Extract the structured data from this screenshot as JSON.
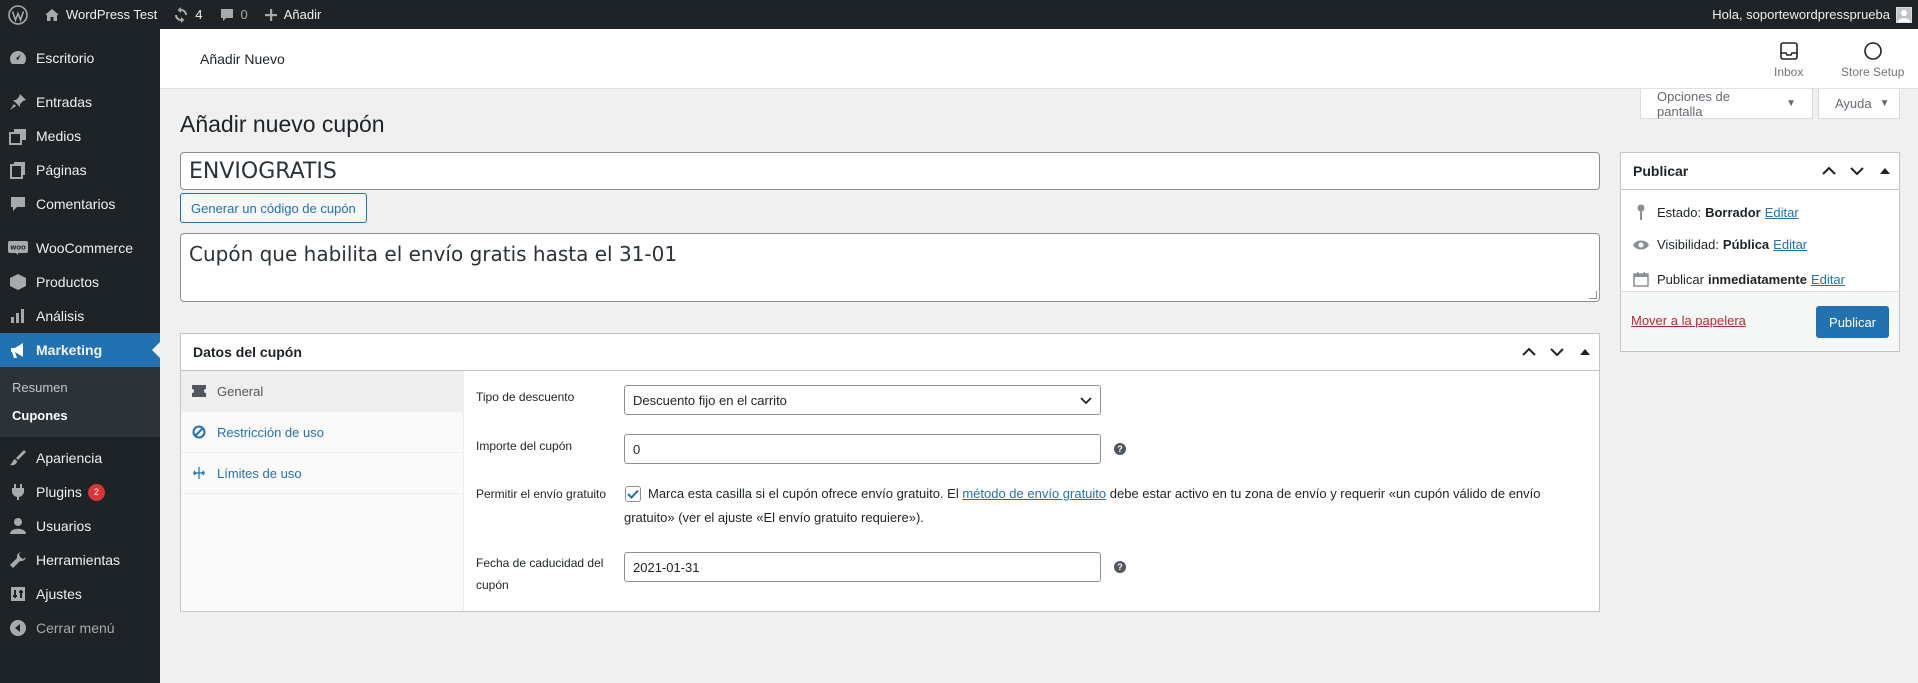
{
  "adminbar": {
    "site_name": "WordPress Test",
    "updates_count": "4",
    "comments_count": "0",
    "new_label": "Añadir",
    "greeting": "Hola, soportewordpressprueba"
  },
  "sidebar": {
    "items": [
      {
        "label": "Escritorio",
        "icon": "dashboard-icon"
      },
      {
        "label": "Entradas",
        "icon": "pin-icon"
      },
      {
        "label": "Medios",
        "icon": "media-icon"
      },
      {
        "label": "Páginas",
        "icon": "page-icon"
      },
      {
        "label": "Comentarios",
        "icon": "comment-icon"
      },
      {
        "label": "WooCommerce",
        "icon": "woo-icon"
      },
      {
        "label": "Productos",
        "icon": "box-icon"
      },
      {
        "label": "Análisis",
        "icon": "chart-icon"
      },
      {
        "label": "Marketing",
        "icon": "megaphone-icon"
      },
      {
        "label": "Apariencia",
        "icon": "brush-icon"
      },
      {
        "label": "Plugins",
        "icon": "plug-icon",
        "badge": "2"
      },
      {
        "label": "Usuarios",
        "icon": "user-icon"
      },
      {
        "label": "Herramientas",
        "icon": "wrench-icon"
      },
      {
        "label": "Ajustes",
        "icon": "settings-icon"
      },
      {
        "label": "Cerrar menú",
        "icon": "collapse-icon"
      }
    ],
    "submenu": [
      "Resumen",
      "Cupones"
    ]
  },
  "wc_header": {
    "title": "Añadir Nuevo",
    "inbox_label": "Inbox",
    "store_setup_label": "Store Setup"
  },
  "screen_meta": {
    "options_label": "Opciones de pantalla",
    "help_label": "Ayuda"
  },
  "page": {
    "title": "Añadir nuevo cupón",
    "coupon_code": "ENVIOGRATIS",
    "generate_button": "Generar un código de cupón",
    "description": "Cupón que habilita el envío gratis hasta el 31-01"
  },
  "coupon_data": {
    "title": "Datos del cupón",
    "tabs": [
      {
        "label": "General",
        "icon": "ticket-icon"
      },
      {
        "label": "Restricción de uso",
        "icon": "no-entry-icon"
      },
      {
        "label": "Límites de uso",
        "icon": "limits-icon"
      }
    ],
    "discount_type_label": "Tipo de descuento",
    "discount_type_value": "Descuento fijo en el carrito",
    "amount_label": "Importe del cupón",
    "amount_value": "0",
    "free_shipping_label": "Permitir el envío gratuito",
    "free_shipping_checked": true,
    "free_shipping_text_1": "Marca esta casilla si el cupón ofrece envío gratuito. El ",
    "free_shipping_link": "método de envío gratuito",
    "free_shipping_text_2": " debe estar activo en tu zona de envío y requerir «un cupón válido de envío gratuito» (ver el ajuste «El envío gratuito requiere»).",
    "expiry_label_1": "Fecha de caducidad del",
    "expiry_label_2": "cupón",
    "expiry_value": "2021-01-31"
  },
  "publish": {
    "title": "Publicar",
    "status_label": "Estado:",
    "status_value": "Borrador",
    "visibility_label": "Visibilidad:",
    "visibility_value": "Pública",
    "publish_label": "Publicar",
    "publish_value": "inmediatamente",
    "edit_link": "Editar",
    "trash_link": "Mover a la papelera",
    "publish_button": "Publicar"
  },
  "colors": {
    "accent": "#2271b1",
    "sidebar_bg": "#1d2327",
    "danger": "#b32d2e",
    "badge": "#d63638"
  }
}
